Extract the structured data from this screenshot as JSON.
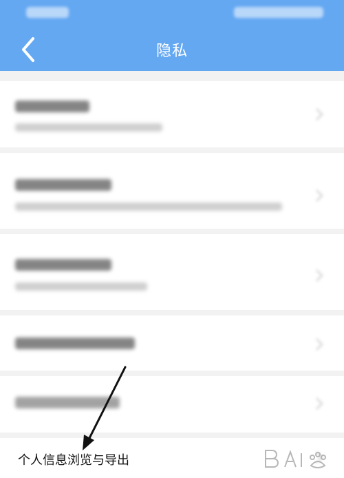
{
  "header": {
    "title": "隐私",
    "accent_color": "#64a8f2"
  },
  "list": {
    "rows_visible": 5
  },
  "annotation": {
    "caption": "个人信息浏览与导出"
  },
  "icons": {
    "back": "chevron-left-icon",
    "row_chevron": "chevron-right-icon",
    "arrow": "annotation-arrow-icon"
  }
}
